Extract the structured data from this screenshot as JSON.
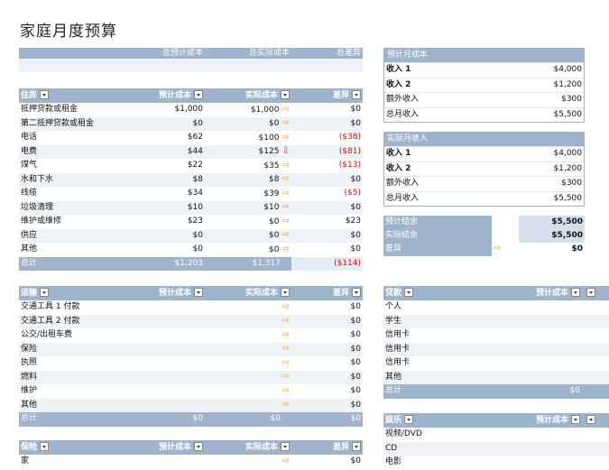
{
  "title": "家庭月度预算",
  "summary_header": {
    "planned": "总预计成本",
    "actual": "总实际成本",
    "diff": "总差异"
  },
  "housing": {
    "headers": [
      "住房",
      "预计成本",
      "实际成本",
      "差异"
    ],
    "rows": [
      {
        "name": "抵押贷款或租金",
        "planned": "$1,000",
        "actual": "$1,000",
        "arrow": "right",
        "diff": "$0"
      },
      {
        "name": "第二抵押贷款或租金",
        "planned": "$0",
        "actual": "$0",
        "arrow": "right",
        "diff": "$0"
      },
      {
        "name": "电话",
        "planned": "$62",
        "actual": "$100",
        "arrow": "right",
        "diff": "($38)"
      },
      {
        "name": "电费",
        "planned": "$44",
        "actual": "$125",
        "arrow": "down",
        "diff": "($81)"
      },
      {
        "name": "煤气",
        "planned": "$22",
        "actual": "$35",
        "arrow": "right",
        "diff": "($13)"
      },
      {
        "name": "水和下水",
        "planned": "$8",
        "actual": "$8",
        "arrow": "right",
        "diff": "$0"
      },
      {
        "name": "线缆",
        "planned": "$34",
        "actual": "$39",
        "arrow": "right",
        "diff": "($5)"
      },
      {
        "name": "垃圾清理",
        "planned": "$10",
        "actual": "$10",
        "arrow": "right",
        "diff": "$0"
      },
      {
        "name": "维护或维修",
        "planned": "$23",
        "actual": "$0",
        "arrow": "right",
        "diff": "$23"
      },
      {
        "name": "供应",
        "planned": "$0",
        "actual": "$0",
        "arrow": "right",
        "diff": "$0"
      },
      {
        "name": "其他",
        "planned": "$0",
        "actual": "$0",
        "arrow": "right",
        "diff": "$0"
      }
    ],
    "total": {
      "name": "总计",
      "planned": "$1,203",
      "actual": "$1,317",
      "diff": "($114)"
    }
  },
  "transport": {
    "headers": [
      "运输",
      "预计成本",
      "实际成本",
      "差异"
    ],
    "rows": [
      {
        "name": "交通工具 1 付款",
        "planned": "",
        "actual": "",
        "arrow": "right",
        "diff": "$0"
      },
      {
        "name": "交通工具 2 付款",
        "planned": "",
        "actual": "",
        "arrow": "right",
        "diff": "$0"
      },
      {
        "name": "公交/出租车费",
        "planned": "",
        "actual": "",
        "arrow": "right",
        "diff": "$0"
      },
      {
        "name": "保险",
        "planned": "",
        "actual": "",
        "arrow": "right",
        "diff": "$0"
      },
      {
        "name": "执照",
        "planned": "",
        "actual": "",
        "arrow": "right",
        "diff": "$0"
      },
      {
        "name": "燃料",
        "planned": "",
        "actual": "",
        "arrow": "right",
        "diff": "$0"
      },
      {
        "name": "维护",
        "planned": "",
        "actual": "",
        "arrow": "right",
        "diff": "$0"
      },
      {
        "name": "其他",
        "planned": "",
        "actual": "",
        "arrow": "right",
        "diff": "$0"
      }
    ],
    "total": {
      "name": "总计",
      "planned": "$0",
      "actual": "$0",
      "diff": "$0"
    }
  },
  "insurance": {
    "headers": [
      "保险",
      "预计成本",
      "实际成本",
      "差异"
    ],
    "rows": [
      {
        "name": "家",
        "planned": "",
        "actual": "",
        "arrow": "right",
        "diff": "$0"
      }
    ]
  },
  "planned_income": {
    "title": "预计月成本",
    "rows": [
      {
        "name": "收入 1",
        "value": "$4,000",
        "bold": true
      },
      {
        "name": "收入 2",
        "value": "$1,200",
        "bold": true
      },
      {
        "name": "额外收入",
        "value": "$300",
        "bold": false
      },
      {
        "name": "总月收入",
        "value": "$5,500",
        "bold": false
      }
    ]
  },
  "actual_income": {
    "title": "实际月收入",
    "rows": [
      {
        "name": "收入 1",
        "value": "$4,000",
        "bold": true
      },
      {
        "name": "收入 2",
        "value": "$1,200",
        "bold": true
      },
      {
        "name": "额外收入",
        "value": "$300",
        "bold": false
      },
      {
        "name": "总月收入",
        "value": "$5,500",
        "bold": false
      }
    ]
  },
  "balance": {
    "rows": [
      {
        "name": "预计结余",
        "value": "$5,500"
      },
      {
        "name": "实际结余",
        "value": "$5,500"
      },
      {
        "name": "差异",
        "value": "$0"
      }
    ]
  },
  "loans": {
    "headers": [
      "贷款",
      "预计成本"
    ],
    "rows": [
      "个人",
      "学生",
      "信用卡",
      "信用卡",
      "信用卡",
      "其他"
    ],
    "total": {
      "name": "总计",
      "planned": "$0"
    }
  },
  "entertainment": {
    "headers": [
      "娱乐",
      "预计成本"
    ],
    "rows": [
      "视频/DVD",
      "CD",
      "电影"
    ]
  },
  "colors": {
    "header_bg": "#9eb4cc",
    "alt_row": "#eef2f6",
    "negative": "#d01010",
    "arrow": "#f0a020"
  }
}
